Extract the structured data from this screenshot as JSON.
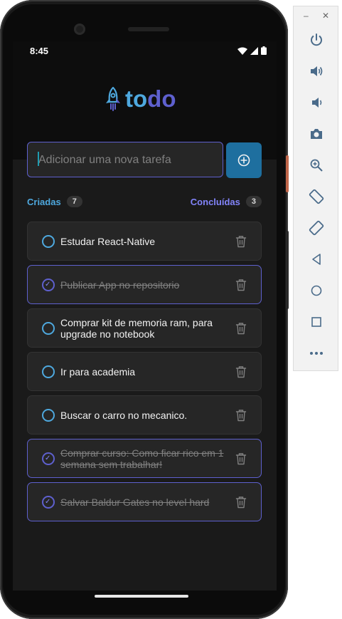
{
  "status_bar": {
    "time": "8:45"
  },
  "app": {
    "logo_part1": "to",
    "logo_part2": "do",
    "input_placeholder": "Adicionar uma nova tarefa",
    "counters": {
      "created_label": "Criadas",
      "created_count": "7",
      "done_label": "Concluídas",
      "done_count": "3"
    },
    "tasks": [
      {
        "text": "Estudar React-Native",
        "completed": false
      },
      {
        "text": "Publicar App no repositorio",
        "completed": true
      },
      {
        "text": "Comprar kit de memoria ram, para upgrade no notebook",
        "completed": false
      },
      {
        "text": "Ir para academia",
        "completed": false
      },
      {
        "text": "Buscar o carro no mecanico.",
        "completed": false
      },
      {
        "text": "Comprar curso: Como ficar rico em 1 semana sem trabalhar!",
        "completed": true
      },
      {
        "text": "Salvar Baldur Gates no level hard",
        "completed": true
      }
    ]
  },
  "colors": {
    "blue": "#4ea8de",
    "purple": "#5e60ce",
    "purple_light": "#8284fa",
    "button_blue": "#1e6f9f",
    "background": "#1a1a1a",
    "card": "#262626"
  },
  "emulator_toolbar": {
    "window_controls": [
      "minimize-icon",
      "close-icon"
    ],
    "buttons": [
      "power-icon",
      "volume-up-icon",
      "volume-down-icon",
      "camera-icon",
      "zoom-icon",
      "rotate-left-icon",
      "rotate-right-icon",
      "back-icon",
      "home-icon",
      "overview-icon",
      "more-icon"
    ]
  }
}
